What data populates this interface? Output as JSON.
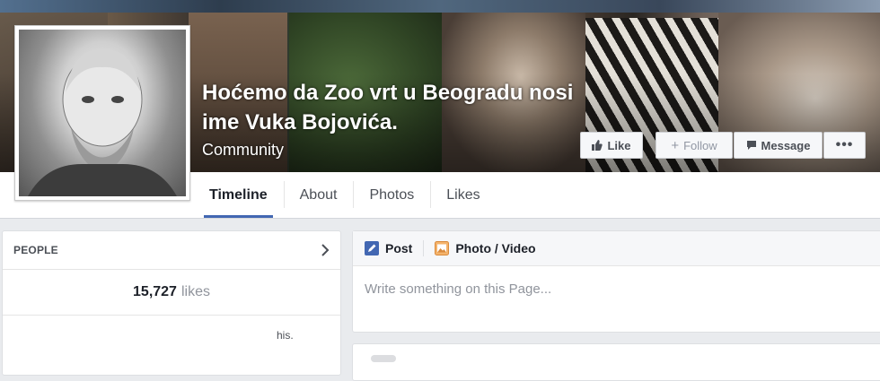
{
  "page": {
    "title": "Hoćemo da Zoo vrt u Beogradu nosi ime Vuka Bojovića.",
    "category": "Community"
  },
  "actions": {
    "like": "Like",
    "follow": "Follow",
    "message": "Message",
    "more": "•••"
  },
  "tabs": [
    {
      "label": "Timeline",
      "active": true
    },
    {
      "label": "About"
    },
    {
      "label": "Photos"
    },
    {
      "label": "Likes"
    }
  ],
  "people": {
    "heading": "PEOPLE",
    "likes_count": "15,727",
    "likes_word": "likes",
    "truncated_text": "his."
  },
  "composer": {
    "post_label": "Post",
    "photo_video_label": "Photo / Video",
    "placeholder": "Write something on this Page..."
  },
  "colors": {
    "accent": "#4267b2",
    "background": "#e9ebee",
    "text_muted": "#90949c"
  }
}
